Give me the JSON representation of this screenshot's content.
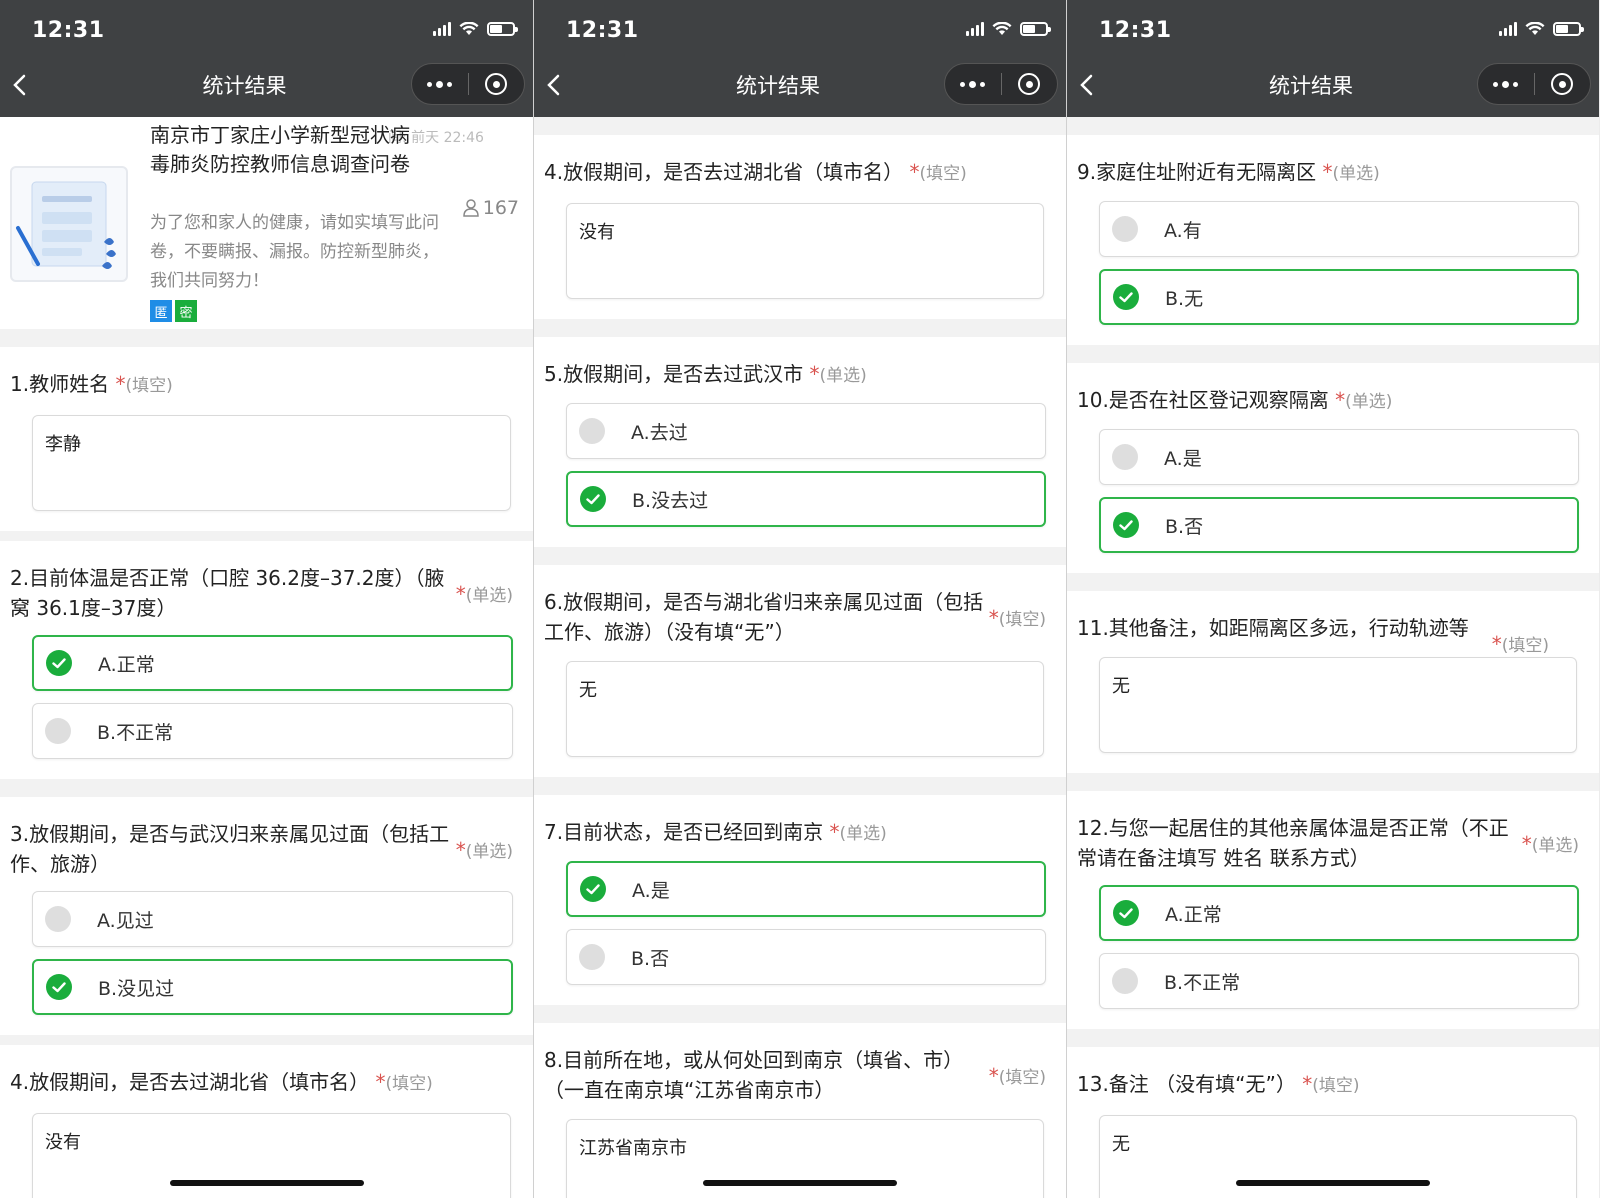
{
  "status": {
    "time": "12:31"
  },
  "nav": {
    "title": "统计结果"
  },
  "colors": {
    "topbar": "#3f4143",
    "accent_green": "#1aad3c",
    "required_red": "#d9534f",
    "badge_blue": "#1f8de6"
  },
  "survey": {
    "title": "南京市丁家庄小学新型冠状病毒肺炎防控教师信息调查问卷",
    "update_time": "间: 前天 22:46",
    "description": "为了您和家人的健康，请如实填写此问卷，不要瞒报、漏报。防控新型肺炎，我们共同努力！",
    "participants": "167",
    "badges": [
      "匿",
      "密"
    ]
  },
  "questions": {
    "q1": {
      "title": "1.教师姓名",
      "type": "(填空)",
      "answer": "李静"
    },
    "q2": {
      "title": "2.目前体温是否正常（口腔 36.2度–37.2度）（腋窝 36.1度–37度）",
      "type": "(单选)",
      "options": [
        "A.正常",
        "B.不正常"
      ],
      "selected": 0
    },
    "q3": {
      "title": "3.放假期间，是否与武汉归来亲属见过面（包括工作、旅游）",
      "type": "(单选)",
      "options": [
        "A.见过",
        "B.没见过"
      ],
      "selected": 1
    },
    "q4": {
      "title": "4.放假期间，是否去过湖北省（填市名）",
      "type": "(填空)",
      "answer": "没有"
    },
    "q5": {
      "title": "5.放假期间，是否去过武汉市",
      "type": "(单选)",
      "options": [
        "A.去过",
        "B.没去过"
      ],
      "selected": 1
    },
    "q6": {
      "title": "6.放假期间，是否与湖北省归来亲属见过面（包括工作、旅游）（没有填“无”）",
      "type": "(填空)",
      "answer": "无"
    },
    "q7": {
      "title": "7.目前状态，是否已经回到南京",
      "type": "(单选)",
      "options": [
        "A.是",
        "B.否"
      ],
      "selected": 0
    },
    "q8": {
      "title": "8.目前所在地，或从何处回到南京（填省、市）（一直在南京填“江苏省南京市）",
      "type": "(填空)",
      "answer": "江苏省南京市"
    },
    "q9": {
      "title": "9.家庭住址附近有无隔离区",
      "type": "(单选)",
      "options": [
        "A.有",
        "B.无"
      ],
      "selected": 1
    },
    "q10": {
      "title": "10.是否在社区登记观察隔离",
      "type": "(单选)",
      "options": [
        "A.是",
        "B.否"
      ],
      "selected": 1
    },
    "q11": {
      "title": "11.其他备注，如距隔离区多远，行动轨迹等",
      "type": "(填空)",
      "answer": "无"
    },
    "q12": {
      "title": "12.与您一起居住的其他亲属体温是否正常（不正常请在备注填写 姓名 联系方式）",
      "type": "(单选)",
      "options": [
        "A.正常",
        "B.不正常"
      ],
      "selected": 0
    },
    "q13": {
      "title": "13.备注 （没有填“无”）",
      "type": "(填空)",
      "answer": "无"
    }
  },
  "required_mark": "*"
}
